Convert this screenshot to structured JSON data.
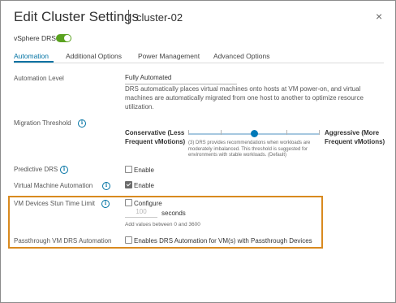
{
  "dialog": {
    "title": "Edit Cluster Settings",
    "subtitle": "cluster-02",
    "close_icon": "×"
  },
  "drs": {
    "label": "vSphere DRS",
    "enabled": true
  },
  "tabs": [
    {
      "label": "Automation",
      "active": true
    },
    {
      "label": "Additional Options",
      "active": false
    },
    {
      "label": "Power Management",
      "active": false
    },
    {
      "label": "Advanced Options",
      "active": false
    }
  ],
  "automation_level": {
    "label": "Automation Level",
    "value": "Fully Automated",
    "description": "DRS automatically places virtual machines onto hosts at VM power-on, and virtual machines are automatically migrated from one host to another to optimize resource utilization."
  },
  "migration_threshold": {
    "label": "Migration Threshold",
    "left_label_1": "Conservative (Less",
    "left_label_2": "Frequent vMotions)",
    "right_label_1": "Aggressive (More",
    "right_label_2": "Frequent vMotions)",
    "level": 3,
    "description": "(3) DRS provides recommendations when workloads are moderately imbalanced. This threshold is suggested for environments with stable workloads. (Default)"
  },
  "predictive_drs": {
    "label": "Predictive DRS",
    "checkbox_label": "Enable",
    "checked": false
  },
  "vm_automation": {
    "label": "Virtual Machine Automation",
    "checkbox_label": "Enable",
    "checked": true
  },
  "stun_time": {
    "label": "VM Devices Stun Time Limit",
    "checkbox_label": "Configure",
    "checked": false,
    "placeholder": "100",
    "unit": "seconds",
    "hint": "Add values between 0 and 3600"
  },
  "passthrough": {
    "label": "Passthrough VM DRS Automation",
    "checkbox_label": "Enables DRS Automation for VM(s) with Passthrough Devices",
    "checked": false
  },
  "colors": {
    "accent": "#0072a3",
    "toggle_on": "#5aa220",
    "highlight": "#d98a1f"
  }
}
